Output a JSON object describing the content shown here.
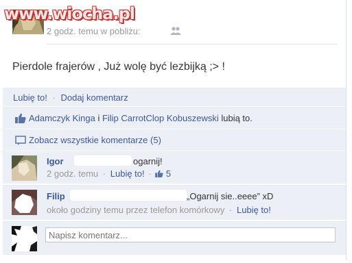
{
  "watermark": "www.wiocha.pl",
  "post": {
    "meta": "2 godz. temu w pobliżu:",
    "status": "Pierdole frajerów , Już wolę być lezbijką ;> !"
  },
  "actions": {
    "like": "Lubię to!",
    "separator": "·",
    "comment": "Dodaj komentarz"
  },
  "likes": {
    "name1": "Adamczyk Kinga",
    "and": " i ",
    "name2": "Filip CarrotClop Kobuszewski",
    "suffix": " lubią to."
  },
  "view_all": "Zobacz wszystkie komentarze (5)",
  "comments": [
    {
      "author": "Igor",
      "text": "ogarnij!",
      "time": "2 godz. temu",
      "separator": "·",
      "like": "Lubię to!",
      "like_count": "5"
    },
    {
      "author": "Filip",
      "text": "„Ogarnij sie..eeee” xD",
      "time": "około godziny temu przez telefon komórkowy",
      "separator": "·",
      "like": "Lubię to!"
    }
  ],
  "input": {
    "placeholder": "Napisz komentarz..."
  },
  "colors": {
    "link": "#3b5998",
    "panel_bg": "#eceff5",
    "muted": "#999999"
  }
}
